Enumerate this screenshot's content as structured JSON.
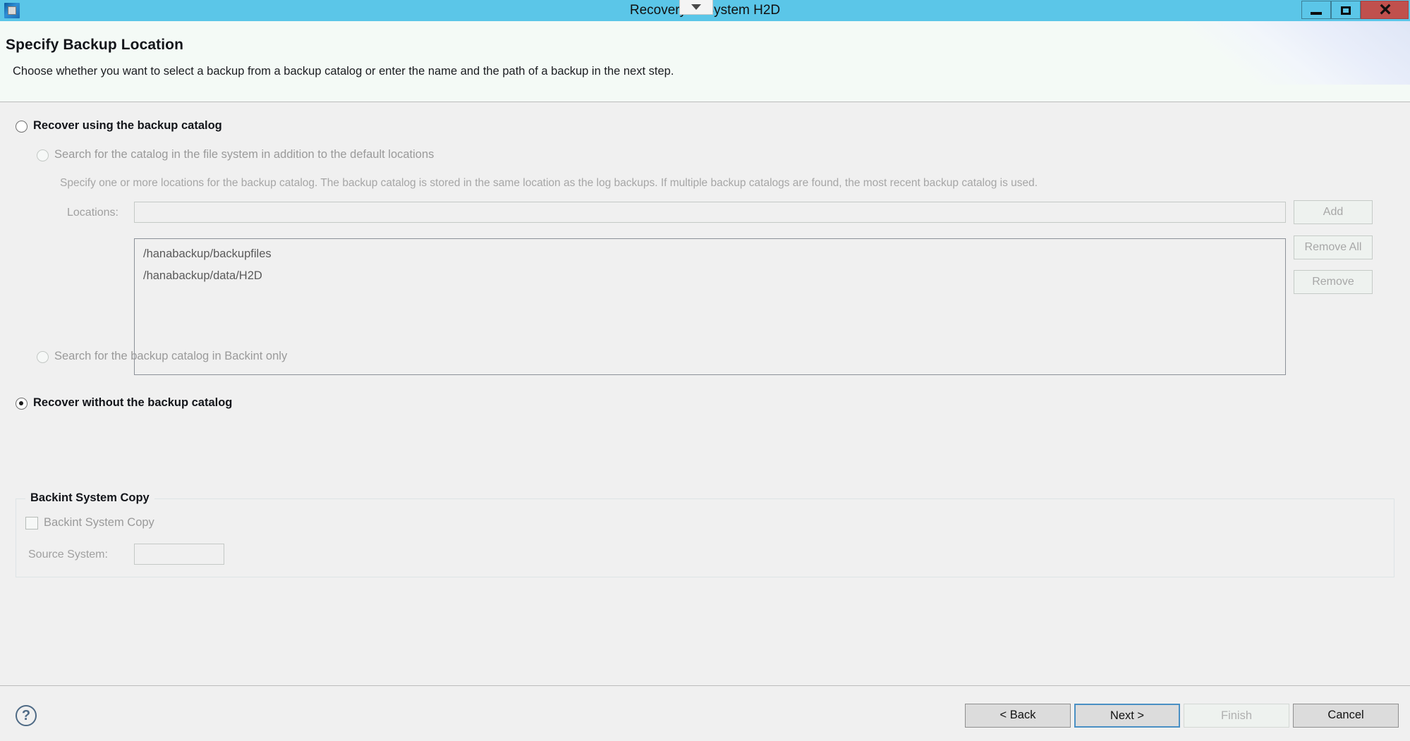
{
  "window": {
    "title": "Recovery of System H2D",
    "app_icon": "chip-icon",
    "controls": {
      "minimize": "minimize-icon",
      "maximize": "maximize-icon",
      "close": "close-icon",
      "close_color": "#c0504d"
    },
    "titlebar_color": "#5bc6e8"
  },
  "header": {
    "title": "Specify Backup Location",
    "description": "Choose whether you want to select a backup from a backup catalog or enter the name and the path of a backup in the next step.",
    "background": "#f4faf6"
  },
  "main": {
    "options": [
      {
        "id": "recover-using-catalog",
        "label": "Recover using the backup catalog",
        "selected": false,
        "enabled": true
      },
      {
        "id": "search-catalog-filesystem",
        "label": "Search for the catalog in the file system in addition to the default locations",
        "selected": false,
        "enabled": false
      },
      {
        "id": "search-catalog-backint",
        "label": "Search for the backup catalog in Backint only",
        "selected": false,
        "enabled": false
      },
      {
        "id": "recover-without-catalog",
        "label": "Recover without the backup catalog",
        "selected": true,
        "enabled": true
      }
    ],
    "catalog_hint": "Specify one or more locations for the backup catalog. The backup catalog is stored in the same location as the log backups. If multiple backup catalogs are found, the most recent backup catalog is used.",
    "locations": {
      "label": "Locations:",
      "input_value": "",
      "input_placeholder": "",
      "enabled": false,
      "items": [
        "/hanabackup/backupfiles",
        "/hanabackup/data/H2D"
      ],
      "buttons": [
        {
          "id": "add",
          "label": "Add",
          "enabled": false
        },
        {
          "id": "remove-all",
          "label": "Remove All",
          "enabled": false
        },
        {
          "id": "remove",
          "label": "Remove",
          "enabled": false
        }
      ]
    },
    "backint_group": {
      "legend": "Backint System Copy",
      "checkbox_label": "Backint System Copy",
      "checkbox_checked": false,
      "checkbox_enabled": false,
      "source_system_label": "Source System:",
      "source_system_value": "",
      "source_system_enabled": false
    }
  },
  "footer": {
    "help_glyph": "?",
    "buttons": [
      {
        "id": "back",
        "label": "< Back",
        "enabled": true,
        "focused": false
      },
      {
        "id": "next",
        "label": "Next >",
        "enabled": true,
        "focused": true
      },
      {
        "id": "finish",
        "label": "Finish",
        "enabled": false,
        "focused": false
      },
      {
        "id": "cancel",
        "label": "Cancel",
        "enabled": true,
        "focused": false
      }
    ]
  }
}
